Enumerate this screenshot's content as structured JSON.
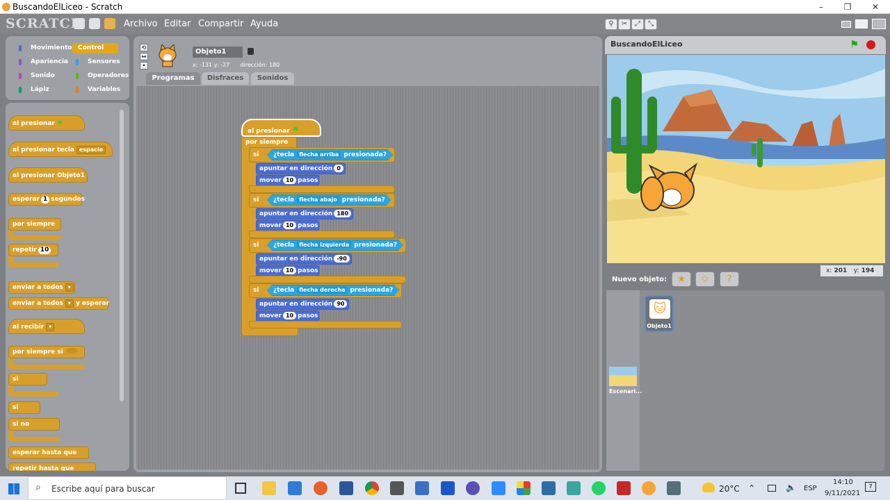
{
  "window": {
    "title": "BuscandoElLiceo - Scratch",
    "min": "–",
    "max": "❐",
    "close": "✕"
  },
  "app": {
    "logo": "SCRATCH"
  },
  "menu": [
    "Archivo",
    "Editar",
    "Compartir",
    "Ayuda"
  ],
  "categories": [
    {
      "label": "Movimiento",
      "color": "#4a6cd4"
    },
    {
      "label": "Control",
      "color": "#e1a91a"
    },
    {
      "label": "Apariencia",
      "color": "#8a55d7"
    },
    {
      "label": "Sensores",
      "color": "#2ca5e2"
    },
    {
      "label": "Sonido",
      "color": "#bb42c3"
    },
    {
      "label": "Operadores",
      "color": "#5cb712"
    },
    {
      "label": "Lápiz",
      "color": "#0e9a6c"
    },
    {
      "label": "Variables",
      "color": "#ee7d16"
    }
  ],
  "palette": {
    "when_flag": "al presionar",
    "when_key": "al presionar tecla",
    "key_value": "espacio",
    "when_sprite": "al presionar  Objeto1",
    "wait": "esperar",
    "wait_value": "1",
    "wait_unit": "segundos",
    "forever": "por siempre",
    "repeat": "repetir",
    "repeat_value": "10",
    "broadcast": "enviar a todos",
    "broadcast_wait": "enviar a todos",
    "and_wait": "y esperar",
    "receive": "al recibir",
    "forever_if": "por siempre si",
    "if": "si",
    "if2": "si",
    "else": "si no",
    "wait_until": "esperar hasta que",
    "repeat_until": "repetir hasta que"
  },
  "sprite": {
    "name": "Objeto1",
    "x_label": "x:",
    "x": "-131",
    "y_label": "y:",
    "y": "-27",
    "dir_label": "dirección:",
    "dir": "180"
  },
  "tabs": [
    {
      "label": "Programas",
      "active": true
    },
    {
      "label": "Disfraces",
      "active": false
    },
    {
      "label": "Sonidos",
      "active": false
    }
  ],
  "script": {
    "hat": "al presionar",
    "forever": "por siempre",
    "ifs": [
      {
        "si": "si",
        "pre": "¿tecla",
        "key": "flecha arriba",
        "post": "presionada?",
        "point": "apuntar en dirección",
        "dir": "0",
        "move": "mover",
        "steps": "10",
        "pasos": "pasos"
      },
      {
        "si": "si",
        "pre": "¿tecla",
        "key": "flecha abajo",
        "post": "presionada?",
        "point": "apuntar en dirección",
        "dir": "180",
        "move": "mover",
        "steps": "10",
        "pasos": "pasos"
      },
      {
        "si": "si",
        "pre": "¿tecla",
        "key": "flecha izquierda",
        "post": "presionada?",
        "point": "apuntar en dirección",
        "dir": "-90",
        "move": "mover",
        "steps": "10",
        "pasos": "pasos"
      },
      {
        "si": "si",
        "pre": "¿tecla",
        "key": "flecha derecha",
        "post": "presionada?",
        "point": "apuntar en dirección",
        "dir": "90",
        "move": "mover",
        "steps": "10",
        "pasos": "pasos"
      }
    ]
  },
  "stage": {
    "title": "BuscandoElLiceo",
    "mouse_x_label": "x:",
    "mouse_x": "201",
    "mouse_y_label": "y:",
    "mouse_y": "194"
  },
  "new_sprite": {
    "label": "Nuevo objeto:"
  },
  "sprites": [
    {
      "name": "Objeto1"
    }
  ],
  "stage_thumb": {
    "name": "Escenari..."
  },
  "taskbar": {
    "search": "Escribe aquí para buscar",
    "temp": "20°C",
    "lang": "ESP",
    "time": "14:10",
    "date": "9/11/2021",
    "notif": "7"
  }
}
